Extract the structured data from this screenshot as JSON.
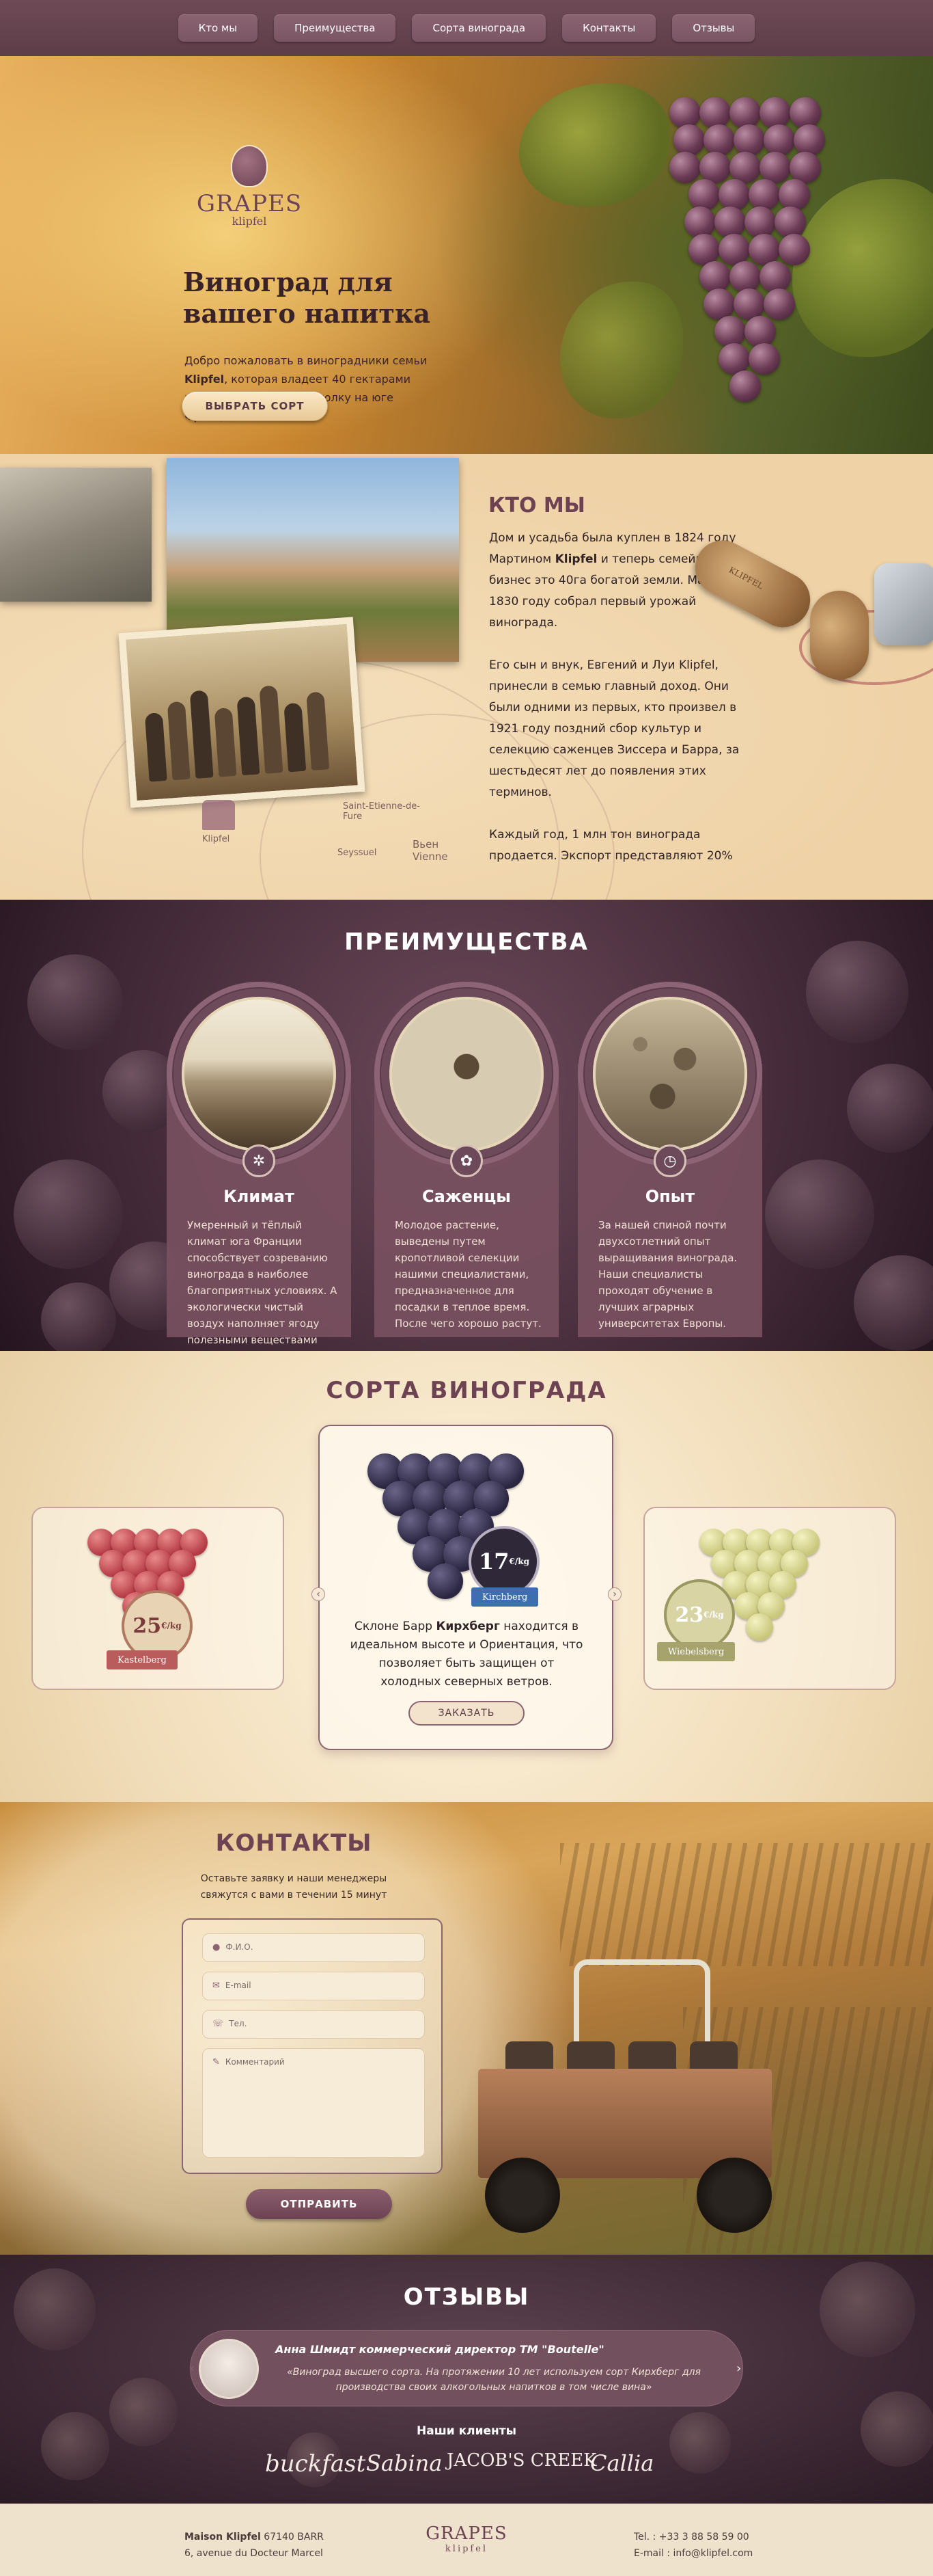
{
  "nav": {
    "items": [
      "Кто мы",
      "Преимущества",
      "Сорта винограда",
      "Контакты",
      "Отзывы"
    ]
  },
  "hero": {
    "logo_title": "GRAPES",
    "logo_sub": "klipfel",
    "title": "Виноград для вашего напитка",
    "text_before": "Добро пожаловать в виноградники семьи ",
    "text_brand": "Klipfel",
    "text_after": ", которая владеет 40 гектарами земли, в живописном уголку на юге Франции",
    "cta": "ВЫБРАТЬ СОРТ"
  },
  "about": {
    "title": "КТО МЫ",
    "p1_a": "Дом и усадьба была куплен в 1824 году Мартином ",
    "p1_brand": "Klipfel",
    "p1_b": " и теперь семейный бизнес это 40га богатой земли. Мартин  в 1830 году собрал первый урожай винограда.",
    "p2": "Его сын и внук, Евгений и Луи Klipfel, принесли в семью главный доход. Они были одними из первых, кто произвел в 1921 году поздний сбор культур и селекцию саженцев Зиссера и Барра, за шестьдесят лет до появления этих терминов.",
    "p3": "Каждый год, 1 млн тон винограда продается. Экспорт представляют 20%",
    "map_label": "Klipfel",
    "map_city": "Вьен Vienne",
    "map_town1": "Saint-Etienne-de-Fure",
    "map_town2": "Seyssuel",
    "cork_label": "KLIPFEL"
  },
  "advantages": {
    "title": "ПРЕИМУЩЕСТВА",
    "cards": [
      {
        "title": "Климат",
        "icon": "compass-icon",
        "glyph": "✲",
        "text": "Умеренный и тёплый климат юга Франции способствует созреванию винограда в наиболее благоприятных условиях. А экологически чистый воздух наполняет ягоду полезными веществами"
      },
      {
        "title": "Саженцы",
        "icon": "sprout-icon",
        "glyph": "✿",
        "text": "Молодое растение, выведены путем кропотливой селекции нашими специалистами, предназначенное для посадки в теплое время. После чего хорошо растут."
      },
      {
        "title": "Опыт",
        "icon": "stopwatch-icon",
        "glyph": "◷",
        "text": "За нашей спиной почти двухсотлетний опыт выращивания винограда. Наши специалисты проходят обучение в лучших аграрных университетах Европы."
      }
    ]
  },
  "sorts": {
    "title": "СОРТА ВИНОГРАДА",
    "left": {
      "price": "25",
      "unit": "€/kg",
      "name": "Kastelberg",
      "color": "#b53a45"
    },
    "center": {
      "price": "17",
      "unit": "€/kg",
      "name": "Kirchberg",
      "color": "#2a2540"
    },
    "right": {
      "price": "23",
      "unit": "€/kg",
      "name": "Wiebelsberg",
      "color": "#c8c67a"
    },
    "desc_a": "Склоне Барр ",
    "desc_brand": "Кирхберг",
    "desc_b": " находится в идеальном высоте и Ориентация, что позволяет быть защищен от холодных северных ветров.",
    "order": "ЗАКАЗАТЬ",
    "prev": "‹",
    "next": "›"
  },
  "contacts": {
    "title": "КОНТАКТЫ",
    "subtitle": "Оставьте заявку и наши менеджеры свяжутся с вами в течении 15 минут",
    "fields": [
      {
        "icon": "user-icon",
        "glyph": "👤",
        "placeholder": "Ф.И.О."
      },
      {
        "icon": "mail-icon",
        "glyph": "✉",
        "placeholder": "E-mail"
      },
      {
        "icon": "phone-icon",
        "glyph": "☏",
        "placeholder": "Тел."
      },
      {
        "icon": "pencil-icon",
        "glyph": "✎",
        "placeholder": "Комментарий"
      }
    ],
    "submit": "ОТПРАВИТЬ"
  },
  "reviews": {
    "title": "ОТЗЫВЫ",
    "name": "Анна Шмидт коммерческий директор ТМ \"Boutelle\"",
    "text": "«Виноград высшего сорта. На протяжении 10 лет используем сорт Кирхберг для производства своих алкогольных напитков в том числе вина»",
    "prev": "‹",
    "next": "›",
    "clients_title": "Наши клиенты",
    "clients": [
      "buckfast",
      "Sabina",
      "JACOB'S CREEK",
      "Callia"
    ]
  },
  "footer": {
    "company": "Maison Klipfel",
    "zip": "67140 BARR",
    "street": "6, avenue du Docteur Marcel",
    "logo_title": "GRAPES",
    "logo_sub": "klipfel",
    "phone": "Tel. : +33 3 88 58 59 00",
    "email": "E-mail : info@klipfel.com"
  }
}
